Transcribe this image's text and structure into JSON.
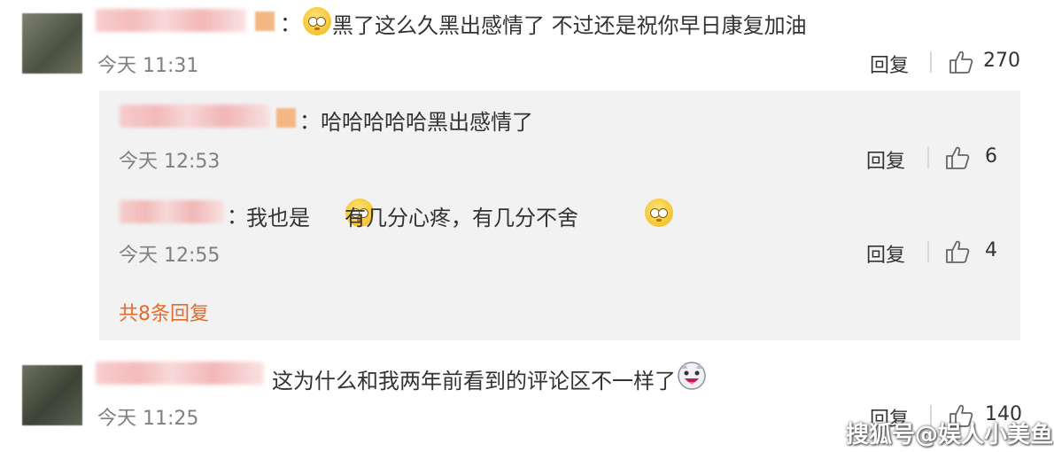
{
  "comments": [
    {
      "text": "黑了这么久黑出感情了 不过还是祝你早日康复加油",
      "time": "今天 11:31",
      "reply_label": "回复",
      "likes": "270"
    },
    {
      "text": "这为什么和我两年前看到的评论区不一样了",
      "time": "今天 11:25",
      "reply_label": "回复",
      "likes": "140"
    }
  ],
  "replies": [
    {
      "text": "哈哈哈哈哈黑出感情了",
      "time": "今天 12:53",
      "reply_label": "回复",
      "likes": "6"
    },
    {
      "text_a": "我也是",
      "text_b": "有几分心疼，有几分不舍",
      "time": "今天 12:55",
      "reply_label": "回复",
      "likes": "4"
    }
  ],
  "more_replies": "共8条回复",
  "colon": "：",
  "watermark": "搜狐号@娱人小美鱼",
  "icons": [
    "blush-emoji-icon",
    "like-thumb-icon",
    "laughing-dog-emoji-icon"
  ],
  "colors": {
    "link": "#e56b2a",
    "panel": "#f2f2f2",
    "time": "#808080"
  }
}
